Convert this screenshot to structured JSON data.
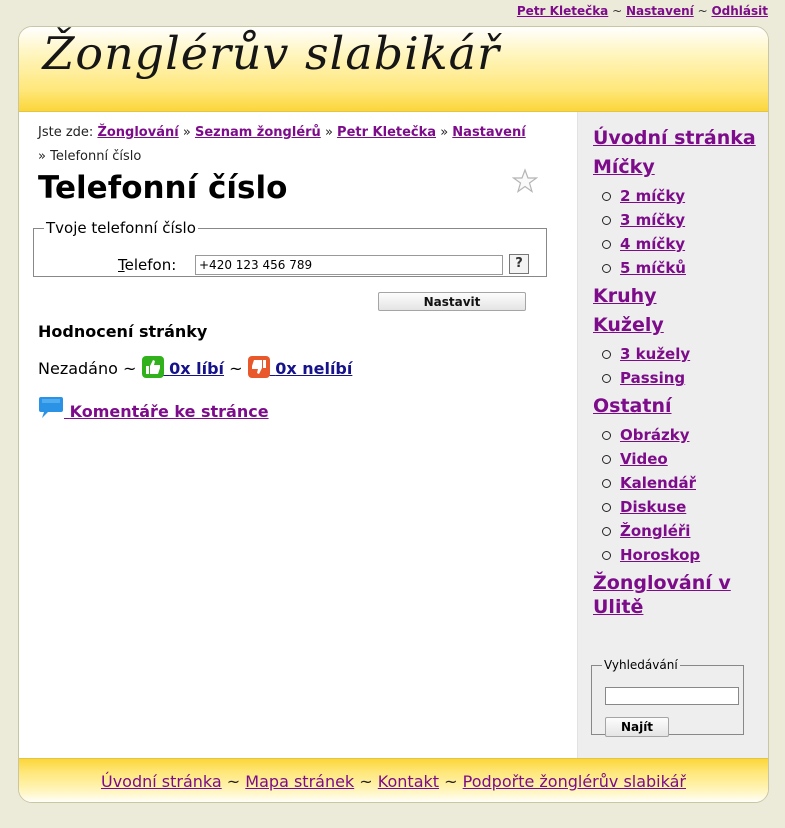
{
  "topbar": {
    "user": "Petr Kletečka",
    "sep": "~",
    "settings": "Nastavení",
    "logout": "Odhlásit"
  },
  "site": {
    "logo": "Žonglérův slabikář"
  },
  "breadcrumb": {
    "prefix": "Jste zde:",
    "sep": "»",
    "items": [
      "Žonglování",
      "Seznam žonglérů",
      "Petr Kletečka",
      "Nastavení"
    ],
    "current": "Telefonní číslo"
  },
  "page": {
    "title": "Telefonní číslo"
  },
  "phone_form": {
    "legend": "Tvoje telefonní číslo",
    "label_accesskey": "T",
    "label_rest": "elefon:",
    "value": "+420 123 456 789",
    "help": "?",
    "submit": "Nastavit"
  },
  "rating": {
    "heading": "Hodnocení stránky",
    "status": "Nezadáno",
    "sep": "~",
    "likes": "0x líbí",
    "dislikes": "0x nelíbí"
  },
  "comments": {
    "label": "Komentáře ke stránce"
  },
  "sidebar": {
    "sections": [
      {
        "label": "Úvodní stránka",
        "items": []
      },
      {
        "label": "Míčky",
        "items": [
          "2 míčky",
          "3 míčky",
          "4 míčky",
          "5 míčků"
        ]
      },
      {
        "label": "Kruhy",
        "items": []
      },
      {
        "label": "Kužely",
        "items": [
          "3 kužely",
          "Passing"
        ]
      },
      {
        "label": "Ostatní",
        "items": [
          "Obrázky",
          "Video",
          "Kalendář",
          "Diskuse",
          "Žongléři",
          "Horoskop"
        ]
      },
      {
        "label": "Žonglování v Ulitě",
        "items": []
      }
    ],
    "search": {
      "legend": "Vyhledávání",
      "value": "",
      "button": "Najít"
    }
  },
  "footer": {
    "sep": "~",
    "links": [
      "Úvodní stránka",
      "Mapa stránek",
      "Kontakt",
      "Podpořte žonglérův slabikář"
    ]
  },
  "colors": {
    "link": "#7d0c8a",
    "vote_link": "#15128a",
    "header_yellow": "#fbd63a",
    "like_green": "#31b21d",
    "dislike_orange": "#e8582a",
    "sidebar_bg": "#eeeeee",
    "page_bg": "#ecebda"
  }
}
